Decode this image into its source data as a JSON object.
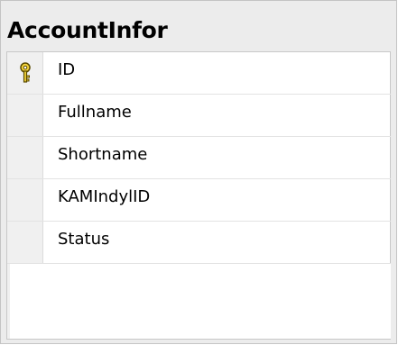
{
  "table": {
    "title": "AccountInfor",
    "columns": [
      {
        "label": "ID",
        "primary_key": true,
        "icon": "key-icon"
      },
      {
        "label": "Fullname",
        "primary_key": false
      },
      {
        "label": "Shortname",
        "primary_key": false
      },
      {
        "label": "KAMIndylID",
        "primary_key": false
      },
      {
        "label": "Status",
        "primary_key": false
      }
    ]
  },
  "colors": {
    "key_icon_fill": "#f2d23a",
    "key_icon_stroke": "#5a4a00",
    "header_background": "#ececec"
  }
}
